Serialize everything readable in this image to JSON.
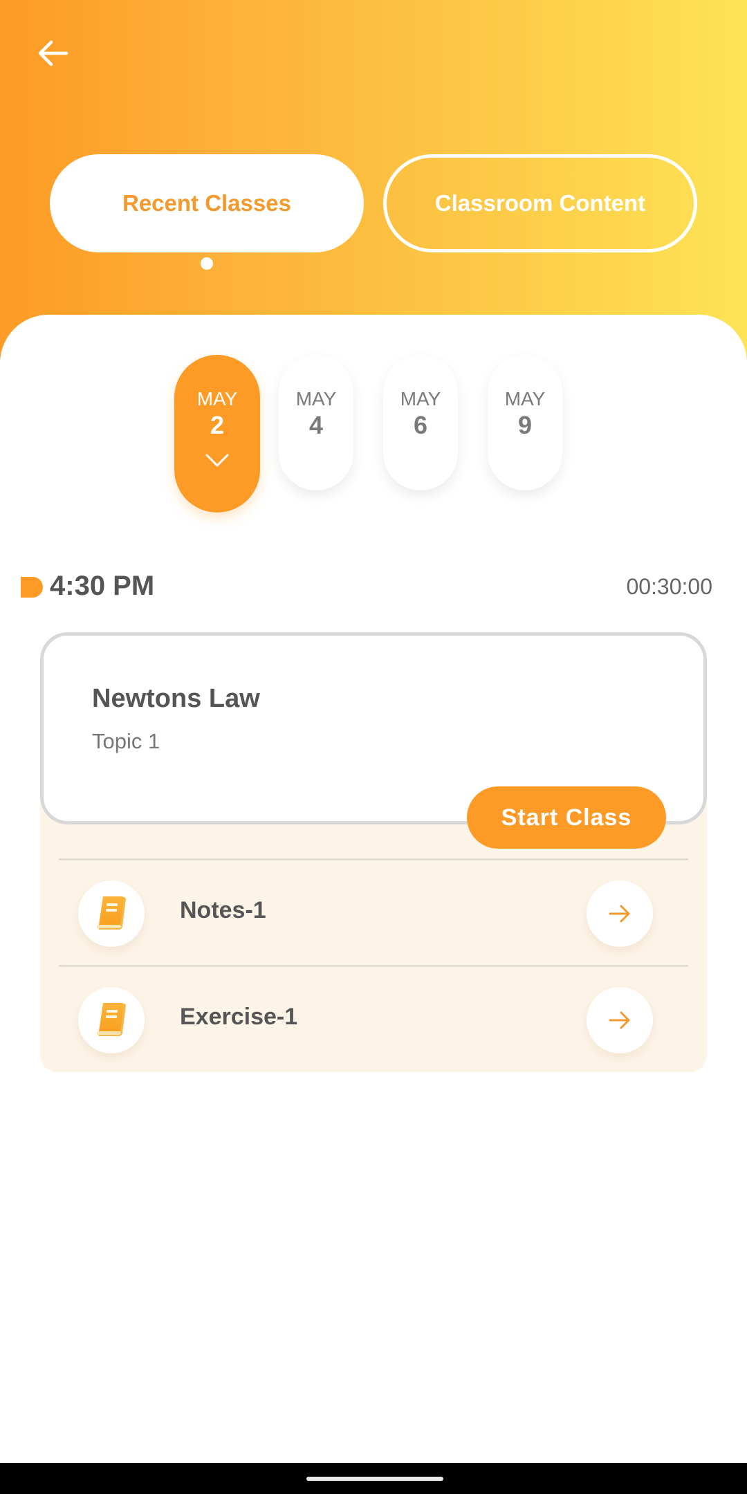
{
  "header": {
    "back_icon": "arrow-left-icon",
    "tabs": [
      {
        "label": "Recent Classes",
        "active": true
      },
      {
        "label": "Classroom Content",
        "active": false
      }
    ]
  },
  "dates": [
    {
      "month": "MAY",
      "day": "2",
      "selected": true
    },
    {
      "month": "MAY",
      "day": "4",
      "selected": false
    },
    {
      "month": "MAY",
      "day": "6",
      "selected": false
    },
    {
      "month": "MAY",
      "day": "9",
      "selected": false
    }
  ],
  "schedule": {
    "time": "4:30 PM",
    "duration": "00:30:00"
  },
  "class_card": {
    "title": "Newtons Law",
    "topic": "Topic 1",
    "start_label": "Start Class"
  },
  "materials": [
    {
      "label": "Notes-1",
      "icon": "book-icon",
      "action_icon": "arrow-right-icon"
    },
    {
      "label": "Exercise-1",
      "icon": "book-icon",
      "action_icon": "arrow-right-icon"
    }
  ],
  "colors": {
    "accent": "#fd9b26",
    "gradient_start": "#fd9b26",
    "gradient_end": "#fee356",
    "panel_bg": "#fdf4e8",
    "text_dark": "#555555"
  }
}
